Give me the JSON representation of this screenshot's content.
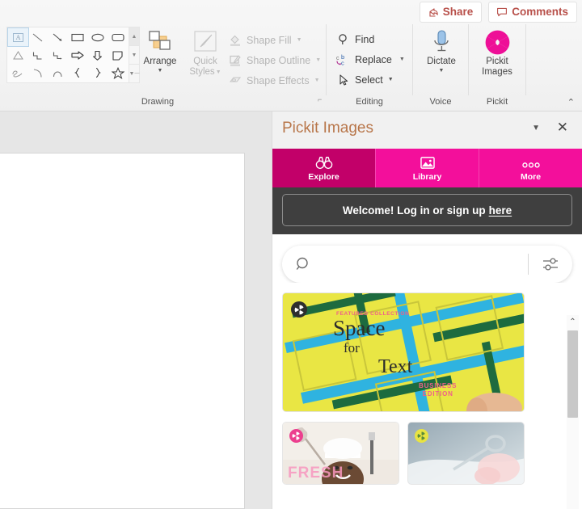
{
  "topbar": {
    "share_label": "Share",
    "comments_label": "Comments"
  },
  "ribbon": {
    "groups": [
      {
        "label": "Drawing"
      },
      {
        "label": "Editing"
      },
      {
        "label": "Voice"
      },
      {
        "label": "Pickit"
      }
    ],
    "drawing": {
      "shapes": [
        "textbox-shape",
        "line-shape",
        "arrow-shape",
        "rectangle-shape",
        "oval-shape",
        "rounded-rectangle-shape",
        "triangle-shape",
        "elbow-connector-shape",
        "elbow-arrow-connector-shape",
        "right-arrow-shape",
        "down-arrow-shape",
        "flowchart-shape",
        "scribble-shape",
        "curve-shape",
        "arc-shape",
        "left-brace-shape",
        "right-brace-shape",
        "star-shape"
      ],
      "arrange_label": "Arrange",
      "quick_styles_label_line1": "Quick",
      "quick_styles_label_line2": "Styles",
      "shape_fill_label": "Shape Fill",
      "shape_outline_label": "Shape Outline",
      "shape_effects_label": "Shape Effects"
    },
    "editing": {
      "find_label": "Find",
      "replace_label": "Replace",
      "select_label": "Select"
    },
    "voice": {
      "dictate_label": "Dictate"
    },
    "pickit": {
      "label_line1": "Pickit",
      "label_line2": "Images"
    }
  },
  "panel": {
    "title": "Pickit Images",
    "tabs": [
      {
        "label": "Explore",
        "icon": "binoculars-icon",
        "active": true
      },
      {
        "label": "Library",
        "icon": "picture-icon",
        "active": false
      },
      {
        "label": "More",
        "icon": "ellipsis-icon",
        "active": false
      }
    ],
    "welcome": {
      "text": "Welcome! Log in or sign up ",
      "link": "here"
    },
    "search": {
      "value": "",
      "placeholder": ""
    },
    "featured": {
      "eyebrow": "FEATURED COLLECTION",
      "line1": "Space",
      "line2": "for",
      "line3": "Text",
      "edition_line1": "BUSINESS",
      "edition_line2": "EDITION",
      "alt": "Yellow and teal geometric paper squares background"
    },
    "thumbnails": [
      {
        "caption": "FRESH",
        "badge_color": "#ec3f8e",
        "alt": "Chef in white hat smiling in kitchen"
      },
      {
        "caption": "",
        "badge_color": "#e8e342",
        "alt": "Surgical instrument held by gloved hand"
      }
    ]
  },
  "colors": {
    "pickit_magenta": "#f30f9b",
    "pickit_magenta_dark": "#c20069",
    "share_red": "#b8504a",
    "panel_title": "#b8764a",
    "welcome_bg": "#3f3f3f"
  }
}
